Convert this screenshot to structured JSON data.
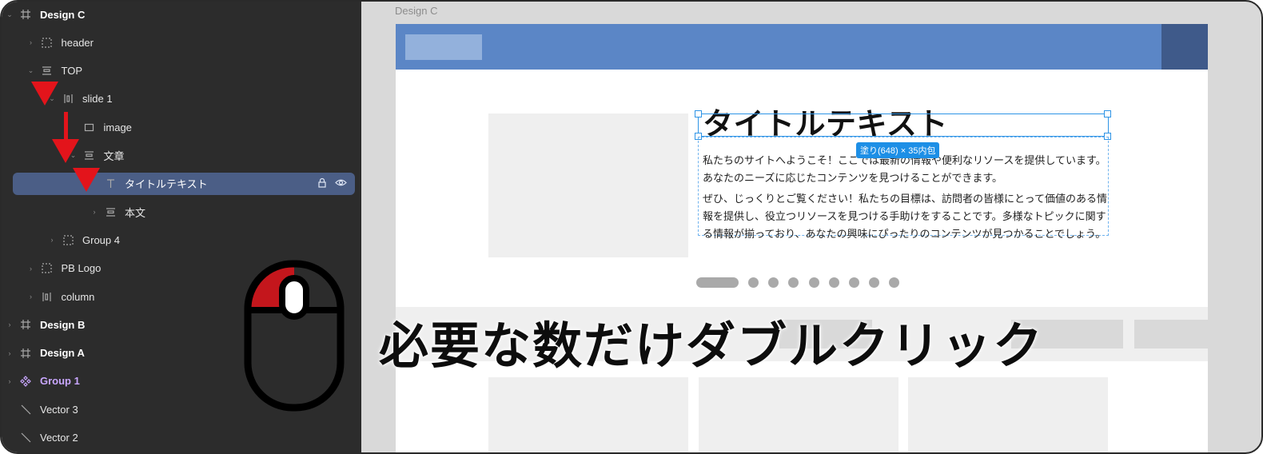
{
  "layers": {
    "items": [
      {
        "label": "Design C",
        "icon": "frame-icon",
        "chevron": "down",
        "indent": 0,
        "bold": true
      },
      {
        "label": "header",
        "icon": "group-dashed-icon",
        "chevron": "right",
        "indent": 1
      },
      {
        "label": "TOP",
        "icon": "autolayout-vertical-icon",
        "chevron": "down",
        "indent": 1
      },
      {
        "label": "slide 1",
        "icon": "autolayout-horizontal-icon",
        "chevron": "down",
        "indent": 2
      },
      {
        "label": "image",
        "icon": "rectangle-icon",
        "chevron": "",
        "indent": 3
      },
      {
        "label": "文章",
        "icon": "autolayout-vertical-icon",
        "chevron": "down",
        "indent": 3
      },
      {
        "label": "タイトルテキスト",
        "icon": "text-icon",
        "chevron": "",
        "indent": 4,
        "selected": true
      },
      {
        "label": "本文",
        "icon": "autolayout-vertical-icon",
        "chevron": "right",
        "indent": 4
      },
      {
        "label": "Group 4",
        "icon": "group-dashed-icon",
        "chevron": "right",
        "indent": 2
      },
      {
        "label": "PB Logo",
        "icon": "group-dashed-icon",
        "chevron": "right",
        "indent": 1
      },
      {
        "label": "column",
        "icon": "autolayout-horizontal-icon",
        "chevron": "right",
        "indent": 1
      },
      {
        "label": "Design B",
        "icon": "frame-icon",
        "chevron": "right",
        "indent": 0,
        "bold": true
      },
      {
        "label": "Design A",
        "icon": "frame-icon",
        "chevron": "right",
        "indent": 0,
        "bold": true
      },
      {
        "label": "Group 1",
        "icon": "component-icon",
        "chevron": "right",
        "indent": 0,
        "bold": true,
        "purple": true
      },
      {
        "label": "Vector 3",
        "icon": "line-icon",
        "chevron": "",
        "indent": 0
      },
      {
        "label": "Vector 2",
        "icon": "line-icon",
        "chevron": "",
        "indent": 0
      }
    ]
  },
  "canvas": {
    "frame_label": "Design C",
    "title_text": "タイトルテキスト",
    "size_tag": "塗り(648) × 35内包",
    "body_paragraph_1": "私たちのサイトへようこそ！ここでは最新の情報や便利なリソースを提供しています。あなたのニーズに応じたコンテンツを見つけることができます。",
    "body_paragraph_2": "ぜひ、じっくりとご覧ください！私たちの目標は、訪問者の皆様にとって価値のある情報を提供し、役立つリソースを見つける手助けをすることです。多様なトピックに関する情報が揃っており、あなたの興味にぴったりのコンテンツが見つかることでしょう。",
    "carousel_dot_count": 8
  },
  "overlay": {
    "caption": "必要な数だけダブルクリック",
    "mouse_icon": "mouse-left-click-icon"
  },
  "colors": {
    "panel_bg": "#2c2c2c",
    "selection_row": "#4b5e86",
    "selection_blue": "#2e94e6",
    "header_blue": "#5b86c6",
    "arrow_red": "#e3141b"
  }
}
